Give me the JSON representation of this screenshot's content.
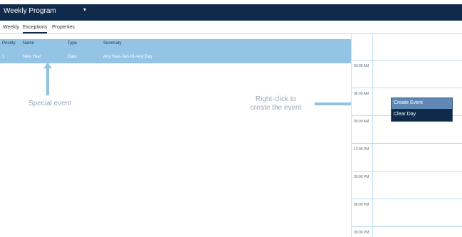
{
  "header": {
    "title": "Weekly Program"
  },
  "tabs": [
    {
      "label": "Weekly"
    },
    {
      "label": "Exceptions"
    },
    {
      "label": "Properties"
    }
  ],
  "table": {
    "columns": [
      "Priority",
      "Name",
      "Type",
      "Summary"
    ],
    "rows": [
      {
        "priority": "1",
        "name": "New Year",
        "type": "Date",
        "summary": "Any Year-Jan-01-Any Day"
      }
    ]
  },
  "calendar": {
    "times": [
      "03:00 AM",
      "06:00 AM",
      "09:00 AM",
      "12:00 PM",
      "03:00 PM",
      "06:00 PM",
      "09:00 PM"
    ]
  },
  "context_menu": {
    "items": [
      "Create Event",
      "Clear Day"
    ]
  },
  "annotations": {
    "special_event": "Special event",
    "right_click_line1": "Right-click to",
    "right_click_line2": "create the event"
  },
  "colors": {
    "header_bg": "#0f2a4a",
    "row_highlight": "#93c4e5",
    "menu_highlight": "#5f88b5",
    "arrow": "#8fc3e6"
  },
  "icons": {
    "header_dropdown": "chevron-down-icon",
    "up_arrow": "arrow-up-icon",
    "right_arrow": "arrow-right-icon"
  }
}
